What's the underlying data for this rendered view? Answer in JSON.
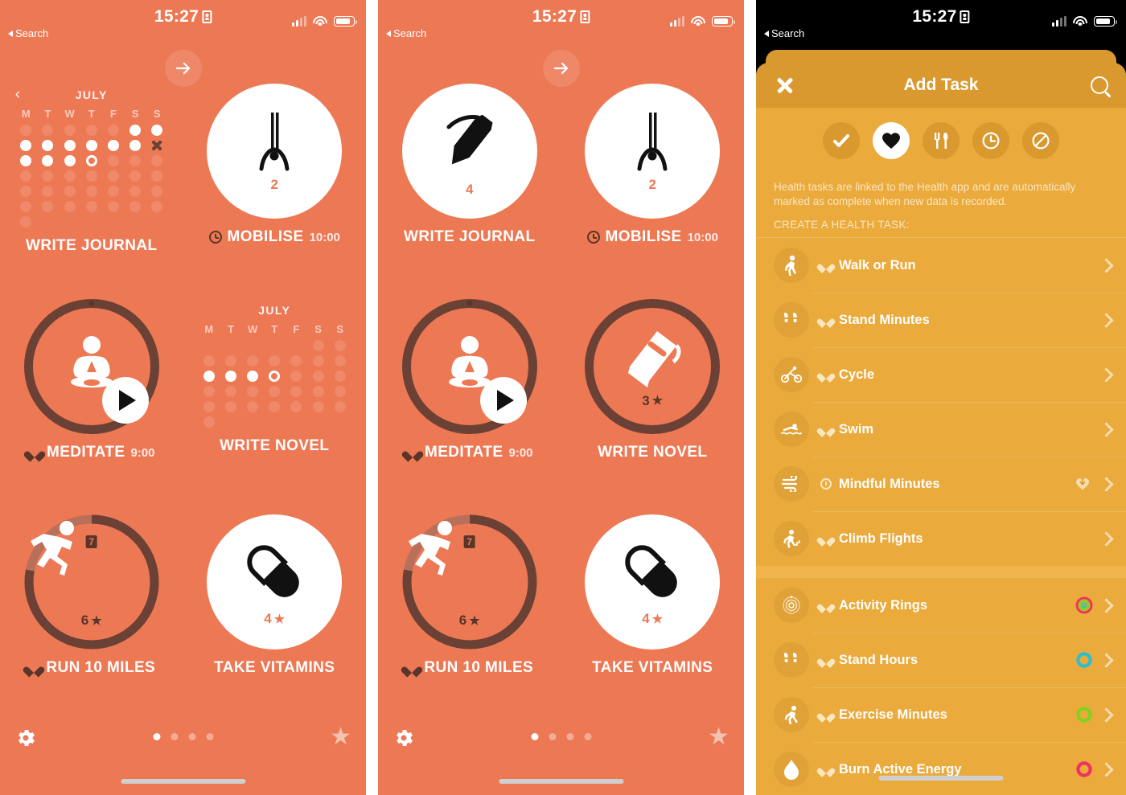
{
  "status_bar": {
    "time": "15:27",
    "back_label": "Search"
  },
  "panels": [
    {
      "name": "habit-grid-page-1",
      "tiles": [
        {
          "type": "calendar",
          "month": "JULY",
          "label": "WRITE JOURNAL",
          "dow": [
            "M",
            "T",
            "W",
            "T",
            "F",
            "S",
            "S"
          ],
          "grid": [
            "e",
            "e",
            "e",
            "e",
            "e",
            "done",
            "done",
            "done",
            "done",
            "done",
            "done",
            "done",
            "done",
            "miss",
            "done",
            "done",
            "done",
            "today",
            "e",
            "e",
            "e",
            "e",
            "e",
            "e",
            "e",
            "e",
            "e",
            "e",
            "e",
            "e",
            "e",
            "e",
            "e",
            "e",
            "e",
            "e",
            "e",
            "e",
            "e",
            "e",
            "e",
            "e",
            "e",
            "x",
            "x",
            "x",
            "x",
            "x",
            "x"
          ]
        },
        {
          "type": "disc",
          "icon": "stretch-icon",
          "count": "2",
          "label": "MOBILISE",
          "time": "10:00",
          "marker": "clock"
        },
        {
          "type": "ring-play",
          "icon": "meditate-icon",
          "label": "MEDITATE",
          "time": "9:00",
          "marker": "heart"
        },
        {
          "type": "calendar",
          "month": "JULY",
          "label": "WRITE NOVEL",
          "dow": [
            "M",
            "T",
            "W",
            "T",
            "F",
            "S",
            "S"
          ],
          "grid": [
            "x",
            "x",
            "x",
            "x",
            "x",
            "e",
            "e",
            "e",
            "e",
            "e",
            "e",
            "e",
            "e",
            "e",
            "done",
            "done",
            "done",
            "today",
            "e",
            "e",
            "e",
            "e",
            "e",
            "e",
            "e",
            "e",
            "e",
            "e",
            "e",
            "e",
            "e",
            "e",
            "e",
            "e",
            "e",
            "e",
            "x",
            "x",
            "x",
            "x",
            "x",
            "x"
          ]
        },
        {
          "type": "progress-ring",
          "icon": "run-icon",
          "badge": "7",
          "count": "6",
          "star": true,
          "label": "RUN 10 MILES",
          "marker": "heart",
          "progress_pct": 78
        },
        {
          "type": "disc",
          "icon": "pill-icon",
          "count": "4",
          "star": true,
          "label": "TAKE VITAMINS"
        }
      ],
      "footer": {
        "gear": "gear-icon",
        "star": "star-icon",
        "dots": 4,
        "active_dot": 0
      }
    },
    {
      "name": "habit-grid-page-2",
      "tiles": [
        {
          "type": "disc",
          "icon": "pen-icon",
          "count": "4",
          "label": "WRITE JOURNAL"
        },
        {
          "type": "disc",
          "icon": "stretch-icon",
          "count": "2",
          "label": "MOBILISE",
          "time": "10:00",
          "marker": "clock"
        },
        {
          "type": "ring-play",
          "icon": "meditate-icon",
          "label": "MEDITATE",
          "time": "9:00",
          "marker": "heart"
        },
        {
          "type": "ring",
          "icon": "book-icon",
          "count": "3",
          "star": true,
          "label": "WRITE NOVEL"
        },
        {
          "type": "progress-ring",
          "icon": "run-icon",
          "badge": "7",
          "count": "6",
          "star": true,
          "label": "RUN 10 MILES",
          "marker": "heart",
          "progress_pct": 78
        },
        {
          "type": "disc",
          "icon": "pill-icon",
          "count": "4",
          "star": true,
          "label": "TAKE VITAMINS"
        }
      ],
      "footer": {
        "gear": "gear-icon",
        "star": "star-icon",
        "dots": 4,
        "active_dot": 0
      }
    }
  ],
  "add_task": {
    "title": "Add Task",
    "close_icon": "close-icon",
    "search_icon": "search-icon",
    "categories": [
      {
        "icon": "check-icon",
        "selected": false
      },
      {
        "icon": "heart-icon",
        "selected": true
      },
      {
        "icon": "food-icon",
        "selected": false
      },
      {
        "icon": "clock-icon",
        "selected": false
      },
      {
        "icon": "no-entry-icon",
        "selected": false
      }
    ],
    "blurb": "Health tasks are linked to the Health app and are automatically marked as complete when new data is recorded.",
    "section_label": "CREATE A HEALTH TASK:",
    "group1": [
      {
        "icon": "walk-icon",
        "marker": "heart",
        "label": "Walk or Run"
      },
      {
        "icon": "footprints-icon",
        "marker": "heart",
        "label": "Stand Minutes"
      },
      {
        "icon": "cycle-icon",
        "marker": "heart",
        "label": "Cycle"
      },
      {
        "icon": "swim-icon",
        "marker": "heart",
        "label": "Swim"
      },
      {
        "icon": "wind-icon",
        "marker": "clock",
        "label": "Mindful Minutes",
        "trailing": "heart-download-icon"
      },
      {
        "icon": "stairs-icon",
        "marker": "heart",
        "label": "Climb Flights"
      }
    ],
    "group2": [
      {
        "icon": "rings-icon",
        "marker": "heart",
        "label": "Activity Rings",
        "ring_color": "#F0335E",
        "ring_inner": "#25C9A8"
      },
      {
        "icon": "footprints-icon",
        "marker": "heart",
        "label": "Stand Hours",
        "ring_color": "#2BBFD0"
      },
      {
        "icon": "run-icon",
        "marker": "heart",
        "label": "Exercise Minutes",
        "ring_color": "#7ED321"
      },
      {
        "icon": "flame-icon",
        "marker": "heart",
        "label": "Burn Active Energy",
        "ring_color": "#F0335E"
      }
    ]
  },
  "colors": {
    "orange": "#ED7854",
    "gold": "#EAAA3C",
    "gold_dark": "#D9992E",
    "brown": "#5A3529"
  }
}
